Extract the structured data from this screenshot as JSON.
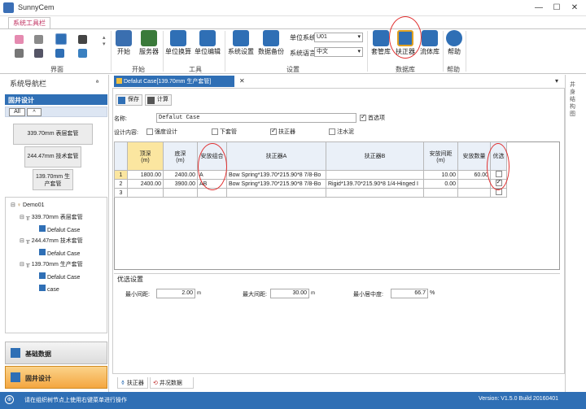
{
  "app": {
    "title": "SunnyCem",
    "ribbon_tab": "系统工具栏"
  },
  "ribbon": {
    "groups": [
      "界面",
      "开始",
      "工具",
      "设置",
      "数据库",
      "帮助"
    ],
    "buttons": [
      {
        "name": "start",
        "label": "开始",
        "color": "#3a6fb0"
      },
      {
        "name": "server",
        "label": "服务器",
        "color": "#3a7a3a"
      },
      {
        "name": "unit-convert",
        "label": "单位换算",
        "color": "#2f6fb5"
      },
      {
        "name": "unit-edit",
        "label": "单位编辑",
        "color": "#2f6fb5"
      },
      {
        "name": "system-settings",
        "label": "系统设置",
        "color": "#2f6fb5"
      },
      {
        "name": "data-backup",
        "label": "数据备份",
        "color": "#2f6fb5"
      },
      {
        "name": "casing-db",
        "label": "套管库",
        "color": "#2f6fb5"
      },
      {
        "name": "centralizer-db",
        "label": "扶正器",
        "color": "#e0a020"
      },
      {
        "name": "fluid-db",
        "label": "流体库",
        "color": "#2f6fb5"
      },
      {
        "name": "help",
        "label": "帮助",
        "color": "#2f6fb5"
      }
    ],
    "unit_system_label": "单位系统",
    "unit_system_value": "U01",
    "language_label": "系统语言",
    "language_value": "中文"
  },
  "nav": {
    "header": "系统导航栏",
    "pin": "ª",
    "section": "固井设计",
    "controls": [
      "All",
      "^"
    ],
    "casing_buttons": [
      "339.70mm 表层套管",
      "244.47mm 技术套管",
      "139.70mm 生产套管"
    ],
    "tree": [
      {
        "label": "Demo01",
        "level": 0
      },
      {
        "label": "339.70mm 表层套管",
        "level": 1
      },
      {
        "label": "Defalut Case",
        "level": 2
      },
      {
        "label": "244.47mm 技术套管",
        "level": 1
      },
      {
        "label": "Defalut Case",
        "level": 2
      },
      {
        "label": "139.70mm 生产套管",
        "level": 1
      },
      {
        "label": "Defalut Case",
        "level": 2
      },
      {
        "label": "case",
        "level": 2
      }
    ],
    "bottom_items": [
      "基础数据",
      "固井设计"
    ]
  },
  "doc": {
    "tab": "Defalut Case[139.70mm 生产套管]",
    "close": "✕",
    "save": "保存",
    "calc": "计算",
    "name_label": "名称:",
    "name_value": "Defalut Case",
    "preferred_label": "首选项",
    "design_label": "设计内容:",
    "options": [
      {
        "label": "强度设计",
        "checked": false
      },
      {
        "label": "下套管",
        "checked": false
      },
      {
        "label": "扶正器",
        "checked": true
      },
      {
        "label": "注水泥",
        "checked": false
      }
    ]
  },
  "grid": {
    "headers": [
      "顶深\n(m)",
      "底深\n(m)",
      "安放组合",
      "扶正器A",
      "扶正器B",
      "安放间距\n(m)",
      "安放数量",
      "优选"
    ],
    "rows": [
      {
        "idx": "1",
        "top": "1800.00",
        "bottom": "2400.00",
        "combo": "A",
        "a": "Bow Spring*139.70*215.90*8 7/8-Bo",
        "b": "",
        "spacing": "10.00",
        "count": "60.00",
        "opt": false
      },
      {
        "idx": "2",
        "top": "2400.00",
        "bottom": "3900.00",
        "combo": "AB",
        "a": "Bow Spring*139.70*215.90*8 7/8-Bo",
        "b": "Rigid*139.70*215.90*8 1/4-Hinged I",
        "spacing": "0.00",
        "count": "",
        "opt": true
      },
      {
        "idx": "3",
        "top": "",
        "bottom": "",
        "combo": "",
        "a": "",
        "b": "",
        "spacing": "",
        "count": "",
        "opt": false
      }
    ]
  },
  "optim": {
    "title": "优选设置",
    "min_spacing_label": "最小间距:",
    "min_spacing_value": "2.00",
    "max_spacing_label": "最大间距:",
    "max_spacing_value": "30.00",
    "min_center_label": "最小居中度:",
    "min_center_value": "66.7",
    "unit_m": "m",
    "unit_pct": "%"
  },
  "bottom_tabs": [
    "扶正器",
    "井况数据"
  ],
  "right_strip": "井身结构图",
  "status": {
    "message": "请在组织树节点上使用右键菜单进行操作",
    "version": "Version:  V1.5.0 Build 20160401"
  }
}
